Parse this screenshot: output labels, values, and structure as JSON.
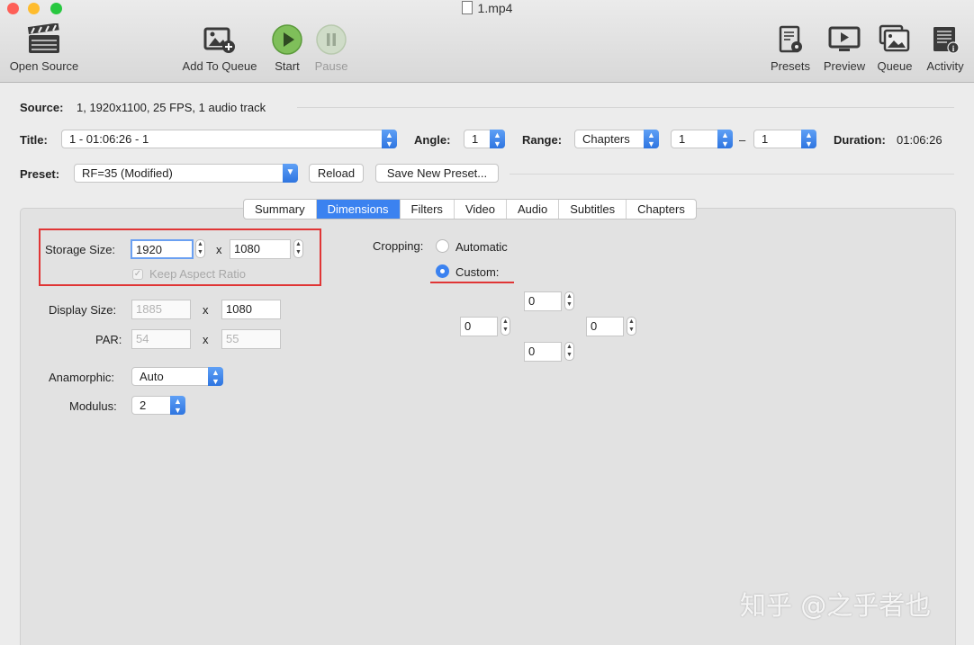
{
  "window": {
    "title": "1.mp4"
  },
  "toolbar": {
    "open_source": "Open Source",
    "add_to_queue": "Add To Queue",
    "start": "Start",
    "pause": "Pause",
    "presets": "Presets",
    "preview": "Preview",
    "queue": "Queue",
    "activity": "Activity"
  },
  "source": {
    "label": "Source:",
    "value": "1, 1920x1100, 25 FPS, 1 audio track"
  },
  "title_row": {
    "label": "Title:",
    "value": "1 - 01:06:26 - 1",
    "angle_label": "Angle:",
    "angle_value": "1",
    "range_label": "Range:",
    "range_type": "Chapters",
    "range_start": "1",
    "range_sep": "–",
    "range_end": "1",
    "duration_label": "Duration:",
    "duration_value": "01:06:26"
  },
  "preset": {
    "label": "Preset:",
    "value": "RF=35 (Modified)",
    "reload": "Reload",
    "save_new": "Save New Preset..."
  },
  "tabs": [
    "Summary",
    "Dimensions",
    "Filters",
    "Video",
    "Audio",
    "Subtitles",
    "Chapters"
  ],
  "active_tab": "Dimensions",
  "dimensions": {
    "storage_label": "Storage Size:",
    "storage_width": "1920",
    "storage_height": "1080",
    "x": "x",
    "keep_aspect": "Keep Aspect Ratio",
    "display_label": "Display Size:",
    "display_width": "1885",
    "display_height": "1080",
    "par_label": "PAR:",
    "par_width": "54",
    "par_height": "55",
    "anamorphic_label": "Anamorphic:",
    "anamorphic_value": "Auto",
    "modulus_label": "Modulus:",
    "modulus_value": "2"
  },
  "cropping": {
    "label": "Cropping:",
    "automatic": "Automatic",
    "custom": "Custom:",
    "top": "0",
    "left": "0",
    "right": "0",
    "bottom": "0"
  },
  "watermark": "知乎 @之乎者也",
  "colors": {
    "accent": "#3b82f0",
    "highlight": "#e03535"
  }
}
